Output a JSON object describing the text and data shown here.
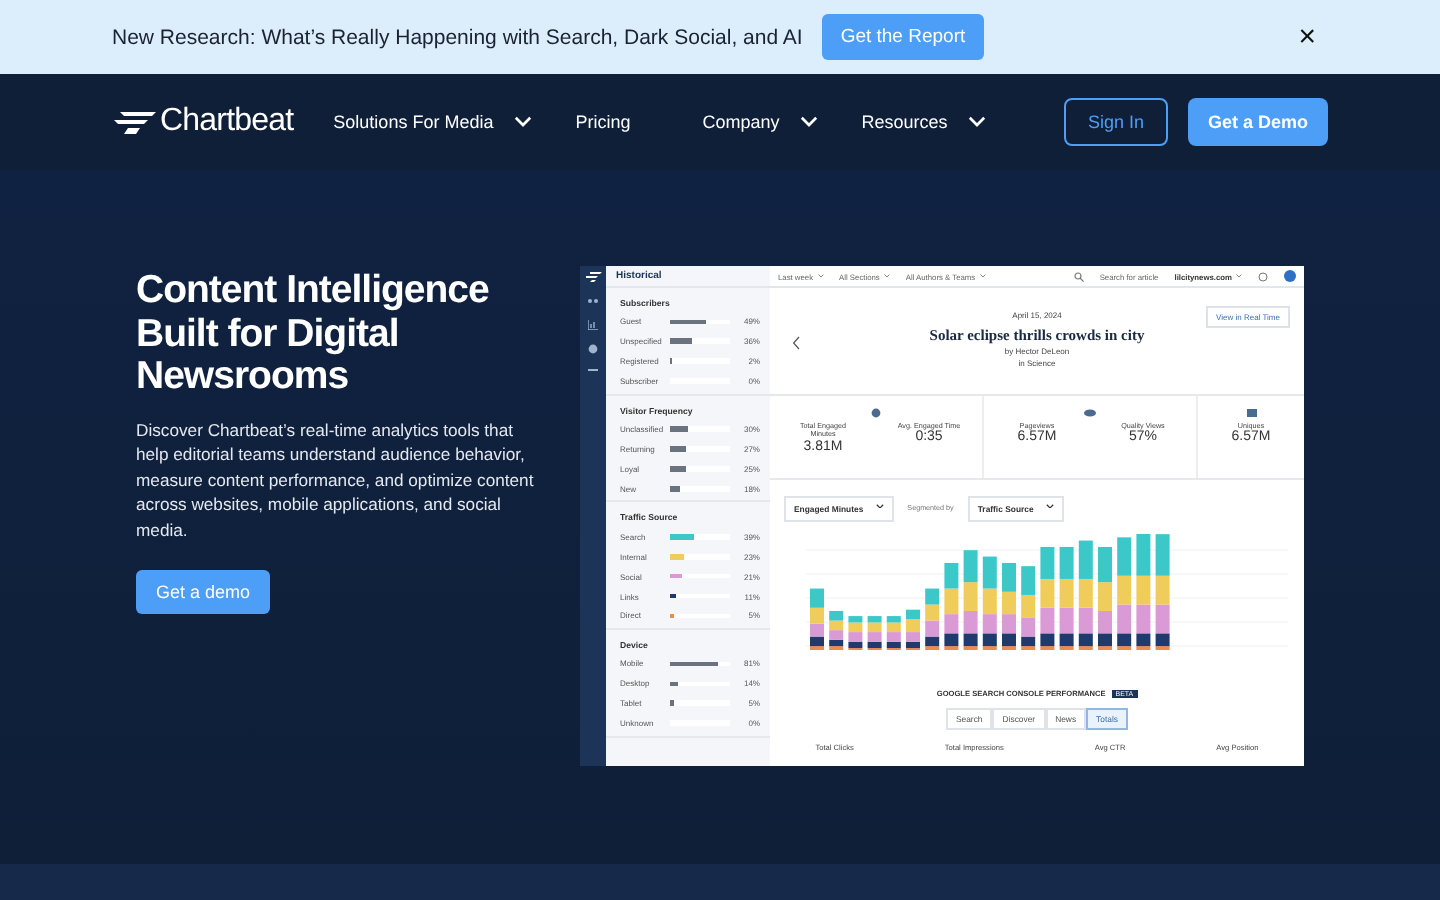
{
  "banner": {
    "text": "New Research: What’s Really Happening with Search, Dark Social, and AI",
    "button": "Get the Report",
    "close": "×"
  },
  "nav": {
    "logo": "Chartbeat",
    "items": [
      {
        "label": "Solutions For Media",
        "dropdown": true
      },
      {
        "label": "Pricing",
        "dropdown": false
      },
      {
        "label": "Company",
        "dropdown": true
      },
      {
        "label": "Resources",
        "dropdown": true
      }
    ],
    "sign_in": "Sign In",
    "demo": "Get a Demo"
  },
  "hero": {
    "title": "Content Intelligence Built for Digital Newsrooms",
    "text": "Discover Chartbeat’s real-time analytics tools that help editorial teams understand audience behavior, measure content performance, and optimize content across websites, mobile applications, and social media.",
    "button": "Get a demo"
  },
  "dashboard": {
    "topbar": {
      "title": "Historical",
      "filters": [
        "Last week",
        "All Sections",
        "All Authors & Teams"
      ],
      "search": "Search for article",
      "site": "lilcitynews.com"
    },
    "sidebar": [
      {
        "title": "Subscribers",
        "rows": [
          {
            "label": "Guest",
            "value": "49%",
            "level": 0.6,
            "color": "#6b7280"
          },
          {
            "label": "Unspecified",
            "value": "36%",
            "level": 0.36,
            "color": "#6b7280"
          },
          {
            "label": "Registered",
            "value": "2%",
            "level": 0.03,
            "color": "#6b7280"
          },
          {
            "label": "Subscriber",
            "value": "0%"
          }
        ]
      },
      {
        "title": "Visitor Frequency",
        "rows": [
          {
            "label": "Unclassified",
            "value": "30%",
            "level": 0.3,
            "color": "#6b7280"
          },
          {
            "label": "Returning",
            "value": "27%",
            "level": 0.27,
            "color": "#6b7280"
          },
          {
            "label": "Loyal",
            "value": "25%",
            "level": 0.25,
            "color": "#6b7280"
          },
          {
            "label": "New",
            "value": "18%",
            "level": 0.18,
            "color": "#6b7280"
          }
        ]
      },
      {
        "title": "Traffic Source",
        "rows": [
          {
            "label": "Search",
            "value": "39%",
            "level": 0.39,
            "color": "#3cc8c8"
          },
          {
            "label": "Internal",
            "value": "23%",
            "level": 0.23,
            "color": "#f0cc5a"
          },
          {
            "label": "Social",
            "value": "21%",
            "level": 0.21,
            "color": "#d99ad6"
          },
          {
            "label": "Links",
            "value": "11%",
            "level": 0.11,
            "color": "#1f3a6e"
          },
          {
            "label": "Direct",
            "value": "5%",
            "level": 0.05,
            "color": "#f08a4b"
          }
        ]
      },
      {
        "title": "Device",
        "rows": [
          {
            "label": "Mobile",
            "value": "81%",
            "level": 0.81,
            "color": "#6b7280"
          },
          {
            "label": "Desktop",
            "value": "14%",
            "level": 0.14,
            "color": "#6b7280"
          },
          {
            "label": "Tablet",
            "value": "5%",
            "level": 0.05,
            "color": "#6b7280"
          },
          {
            "label": "Unknown",
            "value": "0%"
          }
        ]
      }
    ],
    "article": {
      "date": "April 15, 2024",
      "title": "Solar eclipse thrills crowds in city",
      "author": "by Hector DeLeon",
      "section": "in Science",
      "realtime": "View in Real Time"
    },
    "metric_groups": [
      {
        "kind": "clock",
        "metrics": [
          {
            "label": "Total Engaged Minutes",
            "value": "3.81M"
          },
          {
            "label": "Avg. Engaged Time",
            "value": "0:35"
          }
        ]
      },
      {
        "kind": "eye",
        "metrics": [
          {
            "label": "Pageviews",
            "value": "6.57M"
          },
          {
            "label": "Quality Views",
            "value": "57%"
          }
        ]
      },
      {
        "kind": "person",
        "metrics": [
          {
            "label": "Uniques",
            "value": "6.57M"
          }
        ]
      }
    ],
    "chart_controls": {
      "metric": "Engaged Minutes",
      "segmented_label": "Segmented by",
      "segment": "Traffic Source"
    },
    "gsc": {
      "title": "GOOGLE SEARCH CONSOLE PERFORMANCE",
      "badge": "BETA",
      "tabs": [
        {
          "label": "Search",
          "selected": false
        },
        {
          "label": "Discover",
          "selected": false
        },
        {
          "label": "News",
          "selected": false
        },
        {
          "label": "Totals",
          "selected": true
        }
      ],
      "columns": [
        "Total Clicks",
        "Total Impressions",
        "Avg CTR",
        "Avg Position"
      ]
    }
  }
}
